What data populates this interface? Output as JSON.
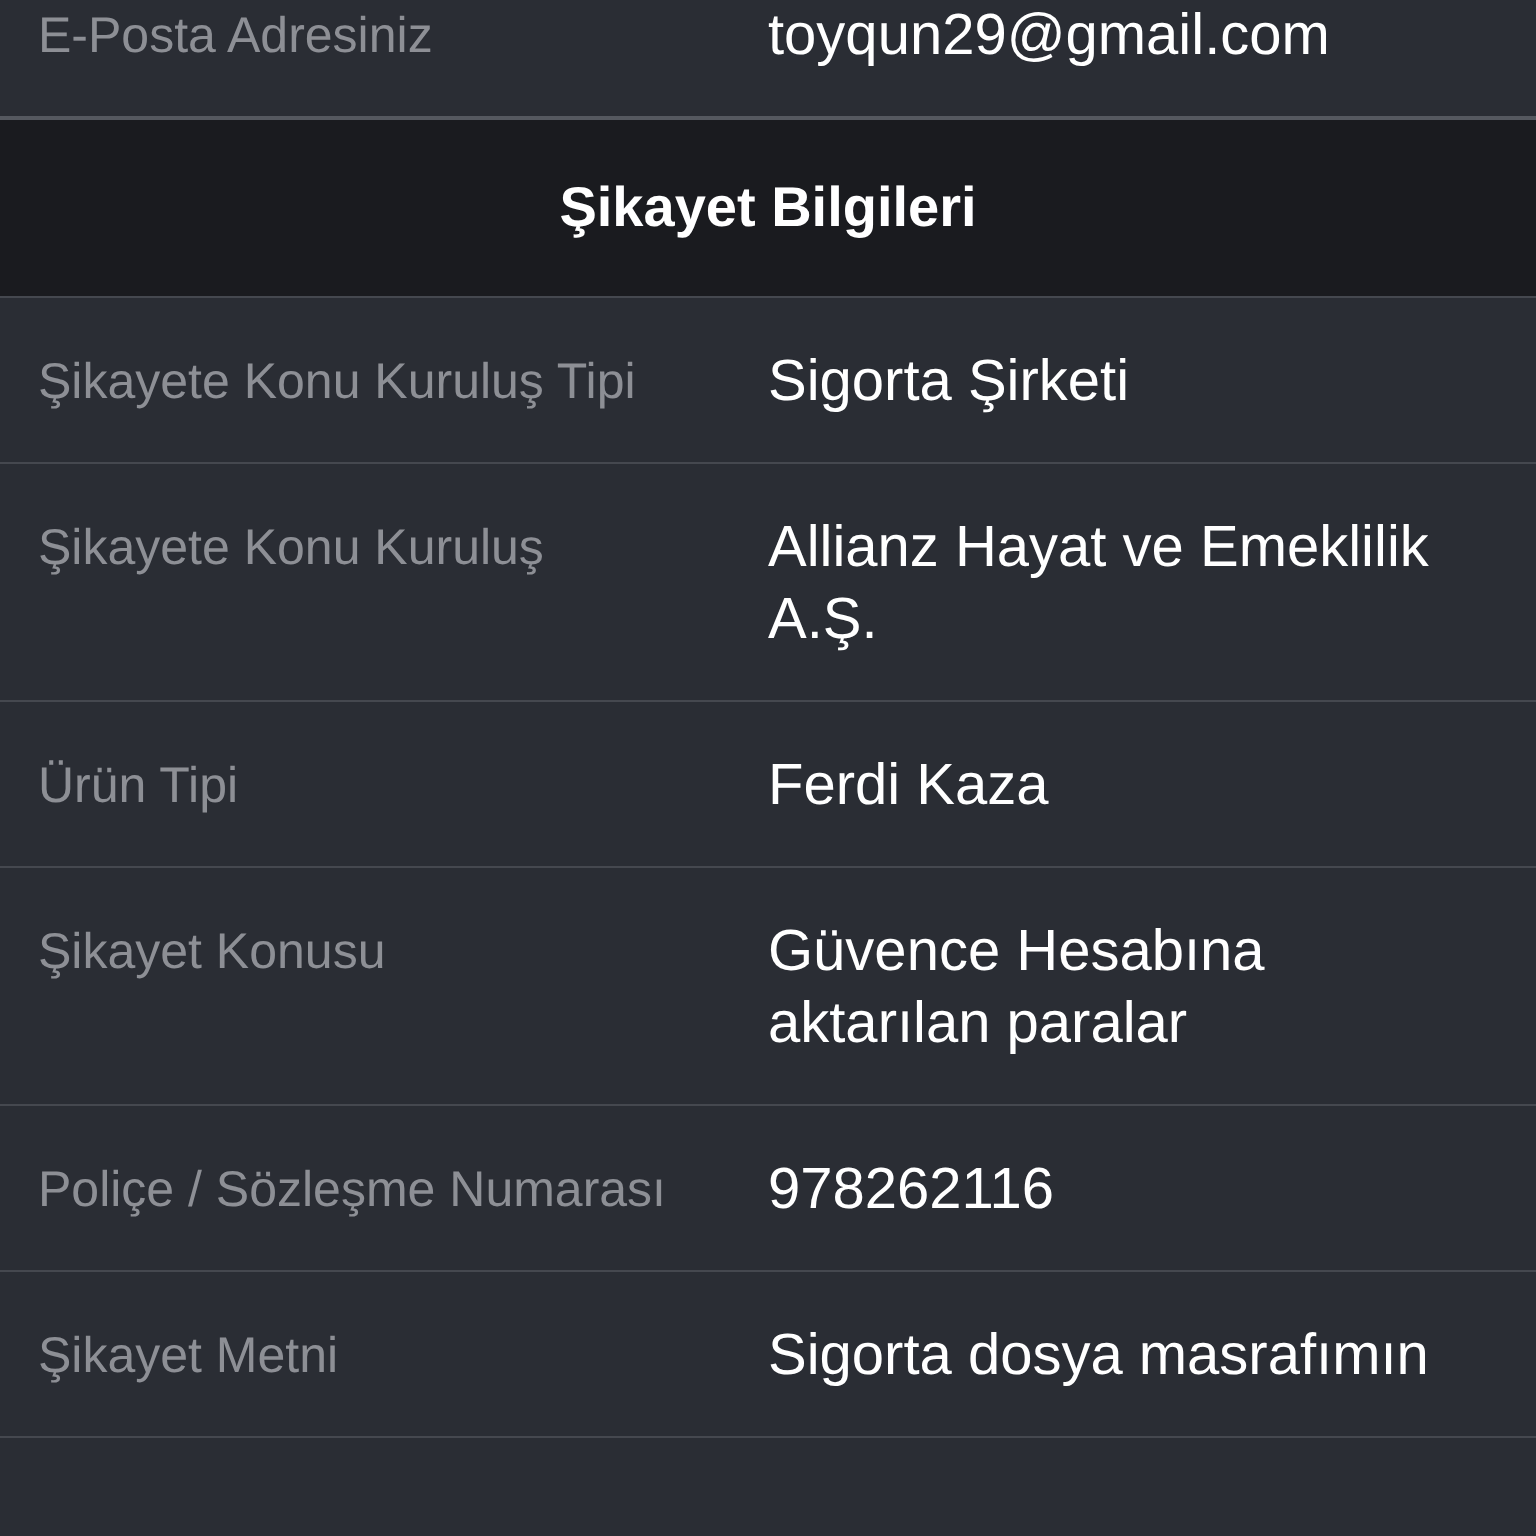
{
  "top_row": {
    "label": "E-Posta Adresiniz",
    "value": "toyqun29@gmail.com"
  },
  "section": {
    "title": "Şikayet Bilgileri",
    "rows": [
      {
        "label": "Şikayete Konu Kuruluş Tipi",
        "value": "Sigorta Şirketi"
      },
      {
        "label": "Şikayete Konu Kuruluş",
        "value": "Allianz Hayat ve Emeklilik A.Ş."
      },
      {
        "label": "Ürün Tipi",
        "value": "Ferdi Kaza"
      },
      {
        "label": "Şikayet Konusu",
        "value": "Güvence Hesabına aktarılan paralar"
      },
      {
        "label": "Poliçe / Sözleşme Numarası",
        "value": "978262116"
      },
      {
        "label": "Şikayet Metni",
        "value": "Sigorta dosya masrafımın"
      }
    ]
  }
}
